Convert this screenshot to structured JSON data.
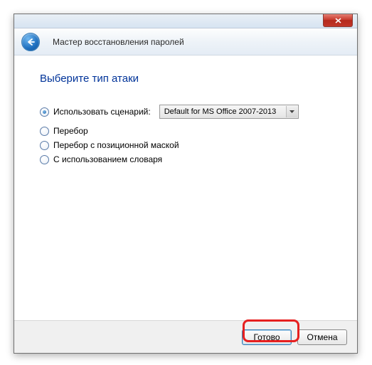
{
  "window": {
    "title": "Мастер восстановления паролей"
  },
  "page": {
    "heading": "Выберите тип атаки"
  },
  "options": {
    "scenario": {
      "label": "Использовать сценарий:",
      "selected_value": "Default for MS Office 2007-2013"
    },
    "brute": {
      "label": "Перебор"
    },
    "mask": {
      "label": "Перебор с позиционной маской"
    },
    "dict": {
      "label": "С использованием словаря"
    }
  },
  "buttons": {
    "done": "Готово",
    "cancel": "Отмена"
  }
}
